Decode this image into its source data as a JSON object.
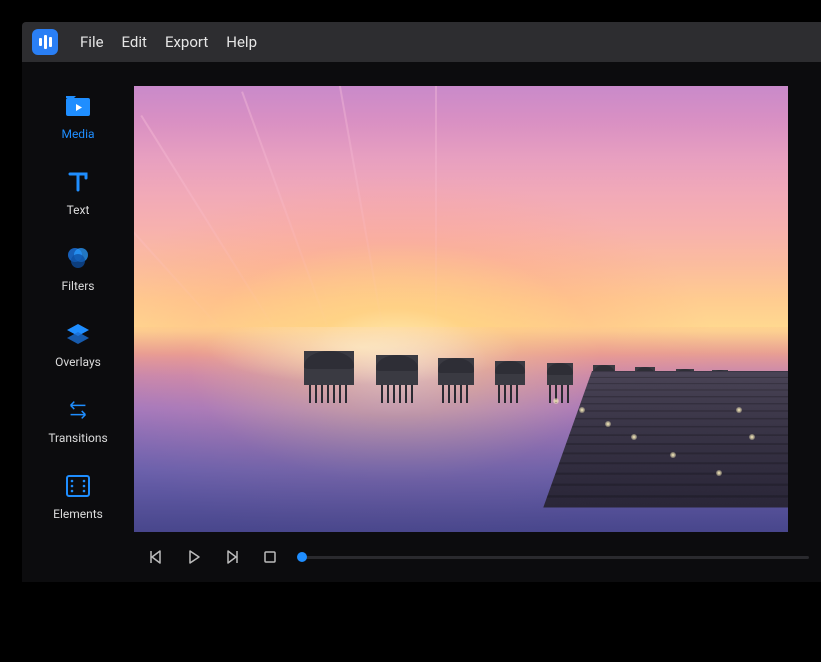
{
  "menu": {
    "items": [
      "File",
      "Edit",
      "Export",
      "Help"
    ]
  },
  "sidebar": {
    "items": [
      {
        "label": "Media",
        "icon": "folder-play-icon",
        "active": true
      },
      {
        "label": "Text",
        "icon": "text-icon",
        "active": false
      },
      {
        "label": "Filters",
        "icon": "filters-icon",
        "active": false
      },
      {
        "label": "Overlays",
        "icon": "overlays-icon",
        "active": false
      },
      {
        "label": "Transitions",
        "icon": "transitions-icon",
        "active": false
      },
      {
        "label": "Elements",
        "icon": "elements-icon",
        "active": false
      }
    ]
  },
  "transport": {
    "buttons": [
      "prev-frame",
      "play",
      "next-frame",
      "stop"
    ],
    "progress": 0
  },
  "colors": {
    "accent": "#1f8eff",
    "menu_bg": "#2d2d30",
    "window_bg": "#0c0c0e",
    "text": "#e6e6e6"
  }
}
